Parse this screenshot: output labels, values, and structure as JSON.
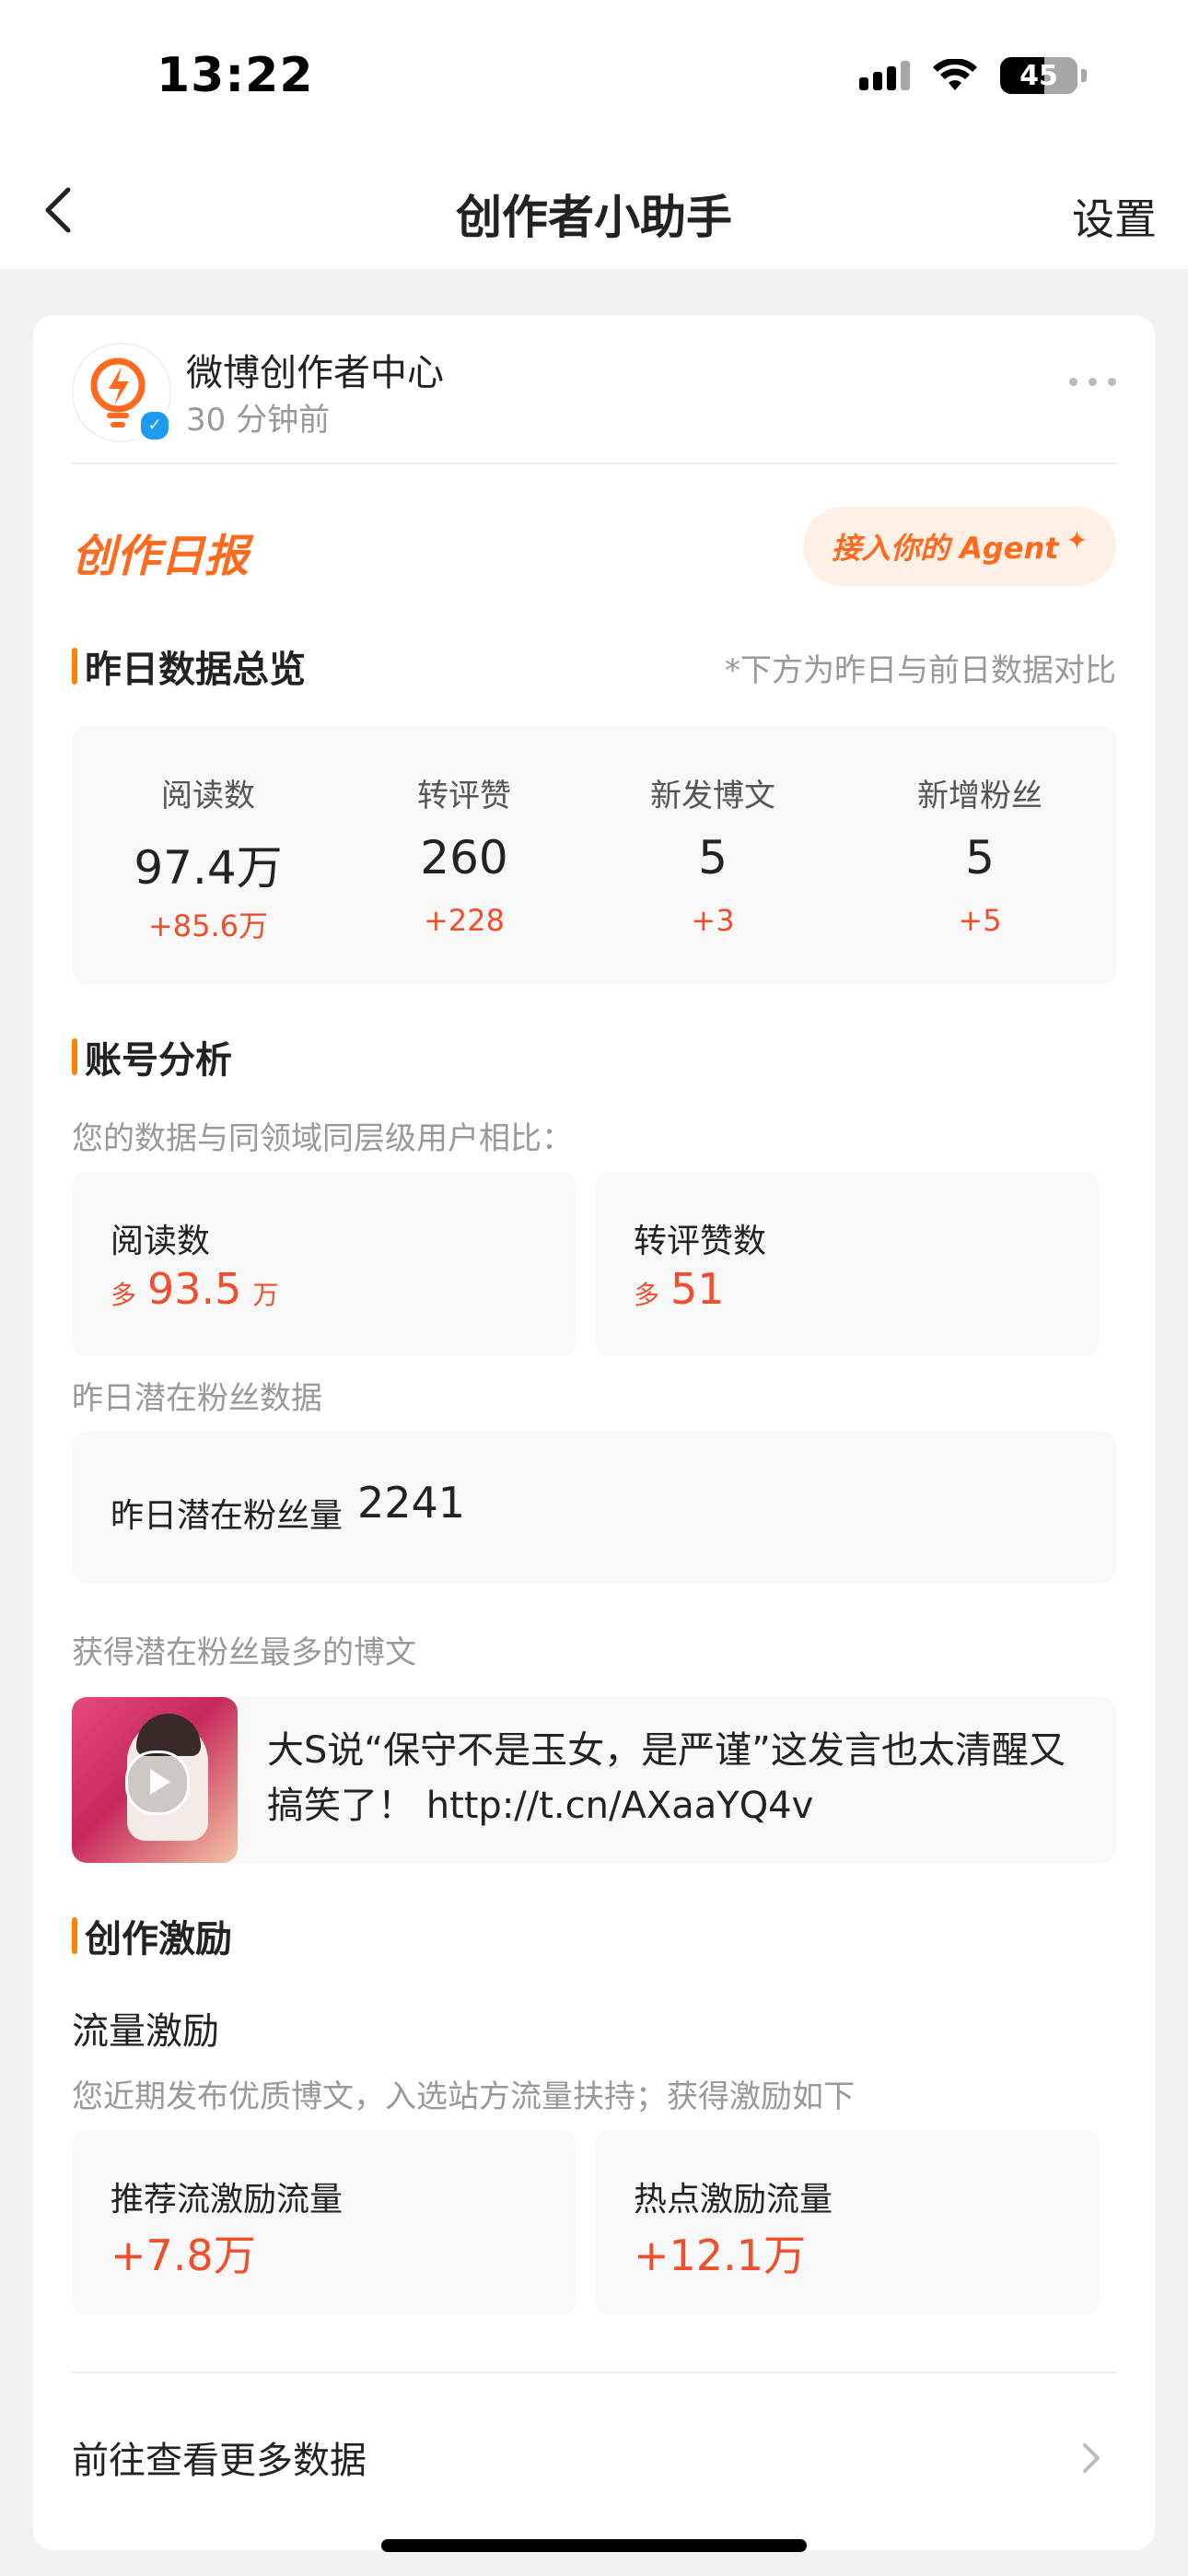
{
  "status_bar": {
    "time": "13:22",
    "battery": "45"
  },
  "nav": {
    "title": "创作者小助手",
    "settings": "设置"
  },
  "account": {
    "name": "微博创作者中心",
    "time": "30 分钟前"
  },
  "report": {
    "title": "创作日报",
    "agent_button": "接入你的 Agent",
    "agent_spark": "✦"
  },
  "overview": {
    "title": "昨日数据总览",
    "note": "*下方为昨日与前日数据对比",
    "stats": [
      {
        "label": "阅读数",
        "value": "97.4万",
        "delta": "+85.6万"
      },
      {
        "label": "转评赞",
        "value": "260",
        "delta": "+228"
      },
      {
        "label": "新发博文",
        "value": "5",
        "delta": "+3"
      },
      {
        "label": "新增粉丝",
        "value": "5",
        "delta": "+5"
      }
    ]
  },
  "analysis": {
    "title": "账号分析",
    "subtitle": "您的数据与同领域同层级用户相比：",
    "cards": [
      {
        "label": "阅读数",
        "prefix": "多",
        "value": "93.5",
        "suffix": "万"
      },
      {
        "label": "转评赞数",
        "prefix": "多",
        "value": "51",
        "suffix": ""
      }
    ],
    "fans_section": "昨日潜在粉丝数据",
    "fans_label": "昨日潜在粉丝量",
    "fans_value": "2241",
    "top_post_section": "获得潜在粉丝最多的博文",
    "top_post_text": "大S说“保守不是玉女，是严谨”这发言也太清醒又搞笑了！ http://t.cn/AXaaYQ4v"
  },
  "incentive": {
    "title": "创作激励",
    "subtitle": "流量激励",
    "description": "您近期发布优质博文，入选站方流量扶持；获得激励如下",
    "cards": [
      {
        "label": "推荐流激励流量",
        "value": "+7.8万"
      },
      {
        "label": "热点激励流量",
        "value": "+12.1万"
      }
    ]
  },
  "more_link": "前往查看更多数据",
  "colors": {
    "accent": "#ff6a1f",
    "delta": "#f24e2c",
    "section_bar": "#ff8200",
    "verified": "#1d9bf0"
  },
  "icons": [
    "back-icon",
    "signal-icon",
    "wifi-icon",
    "battery-icon",
    "verified-icon",
    "more-icon",
    "sparkle-icon",
    "play-icon",
    "chevron-right-icon"
  ]
}
